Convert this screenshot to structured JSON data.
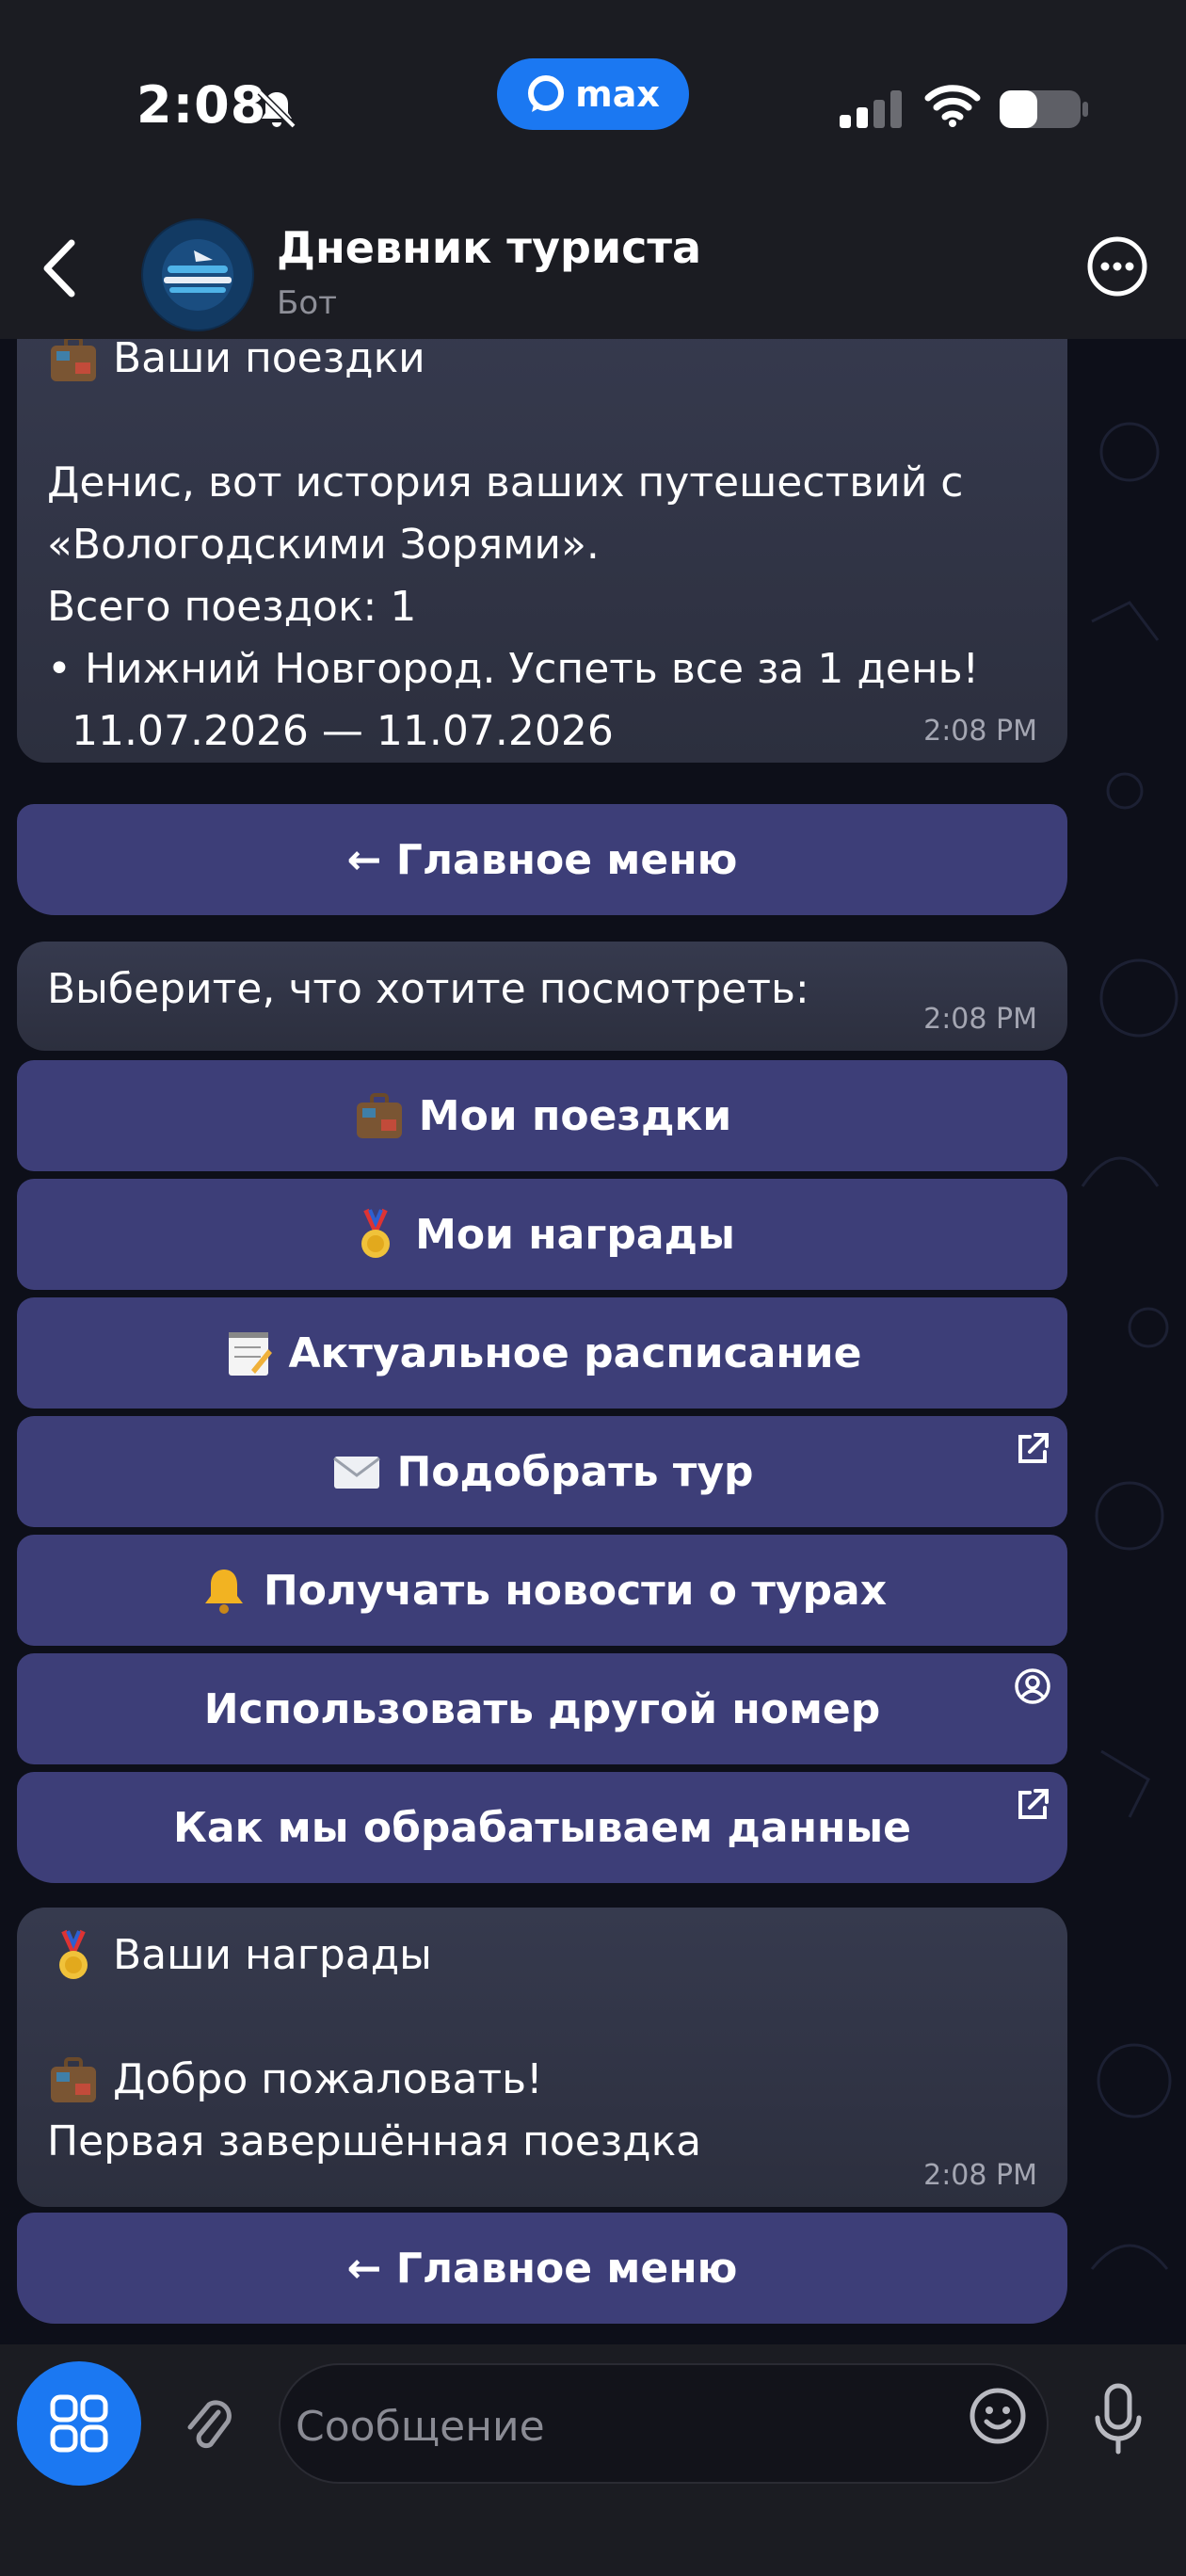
{
  "status_bar": {
    "time": "2:08",
    "app_badge": "max"
  },
  "header": {
    "title": "Дневник туриста",
    "subtitle": "Бот",
    "avatar_text": "АВТОБУСНЫЕ ТУРЫ ИЗ ВОЛОГДЫ"
  },
  "messages": [
    {
      "heading": "Ваши поездки",
      "lines": [
        "Денис, вот история ваших путешествий с",
        "«Вологодскими Зорями».",
        "Всего поездок: 1",
        "• Нижний Новгород. Успеть все за 1 день!",
        "11.07.2026 — 11.07.2026"
      ],
      "time": "2:08 PM",
      "button": "← Главное меню"
    },
    {
      "text": "Выберите, что хотите посмотреть:",
      "time": "2:08 PM"
    },
    {
      "heading": "Ваши награды",
      "award_title": "Добро пожаловать!",
      "award_desc": "Первая завершённая поездка",
      "time": "2:08 PM",
      "button": "← Главное меню"
    }
  ],
  "menu_buttons": [
    {
      "label": "Мои поездки",
      "icon": "suitcase-icon"
    },
    {
      "label": "Мои награды",
      "icon": "medal-icon"
    },
    {
      "label": "Актуальное расписание",
      "icon": "notepad-icon"
    },
    {
      "label": "Подобрать тур",
      "icon": "envelope-icon",
      "corner": "external-link-icon"
    },
    {
      "label": "Получать новости о турах",
      "icon": "bell-icon"
    },
    {
      "label": "Использовать другой номер",
      "corner": "contact-icon"
    },
    {
      "label": "Как мы обрабатываем данные",
      "corner": "external-link-icon"
    }
  ],
  "composer": {
    "placeholder": "Сообщение"
  },
  "colors": {
    "accent": "#1b78f2",
    "button": "#3d3e78",
    "bubble": "#30344a",
    "bar": "#1b1c22"
  }
}
